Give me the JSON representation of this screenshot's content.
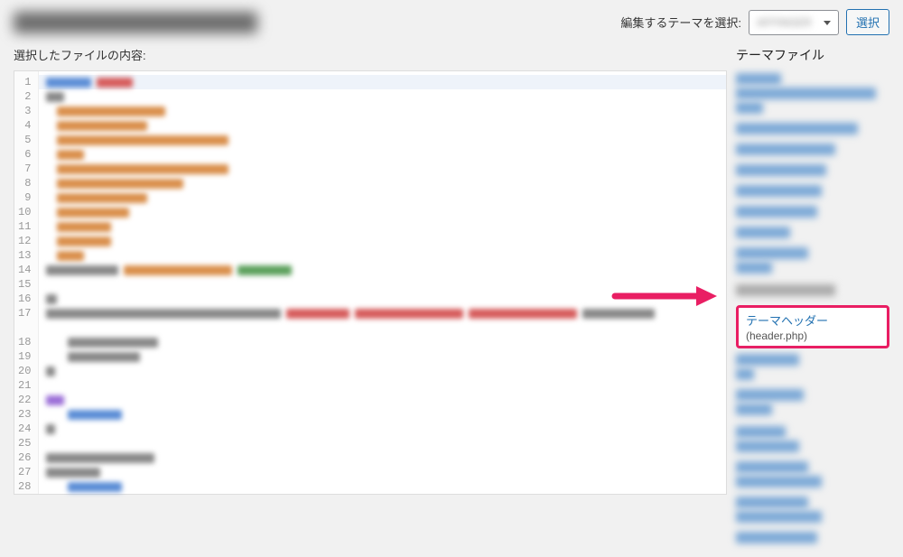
{
  "header": {
    "theme_select_label": "編集するテーマを選択:",
    "theme_name": "AFFINGER",
    "select_button": "選択"
  },
  "editor": {
    "content_label": "選択したファイルの内容:",
    "line_count": 28
  },
  "sidebar": {
    "title": "テーマファイル",
    "highlighted_file": {
      "title": "テーマヘッダー",
      "filename": "(header.php)"
    }
  }
}
